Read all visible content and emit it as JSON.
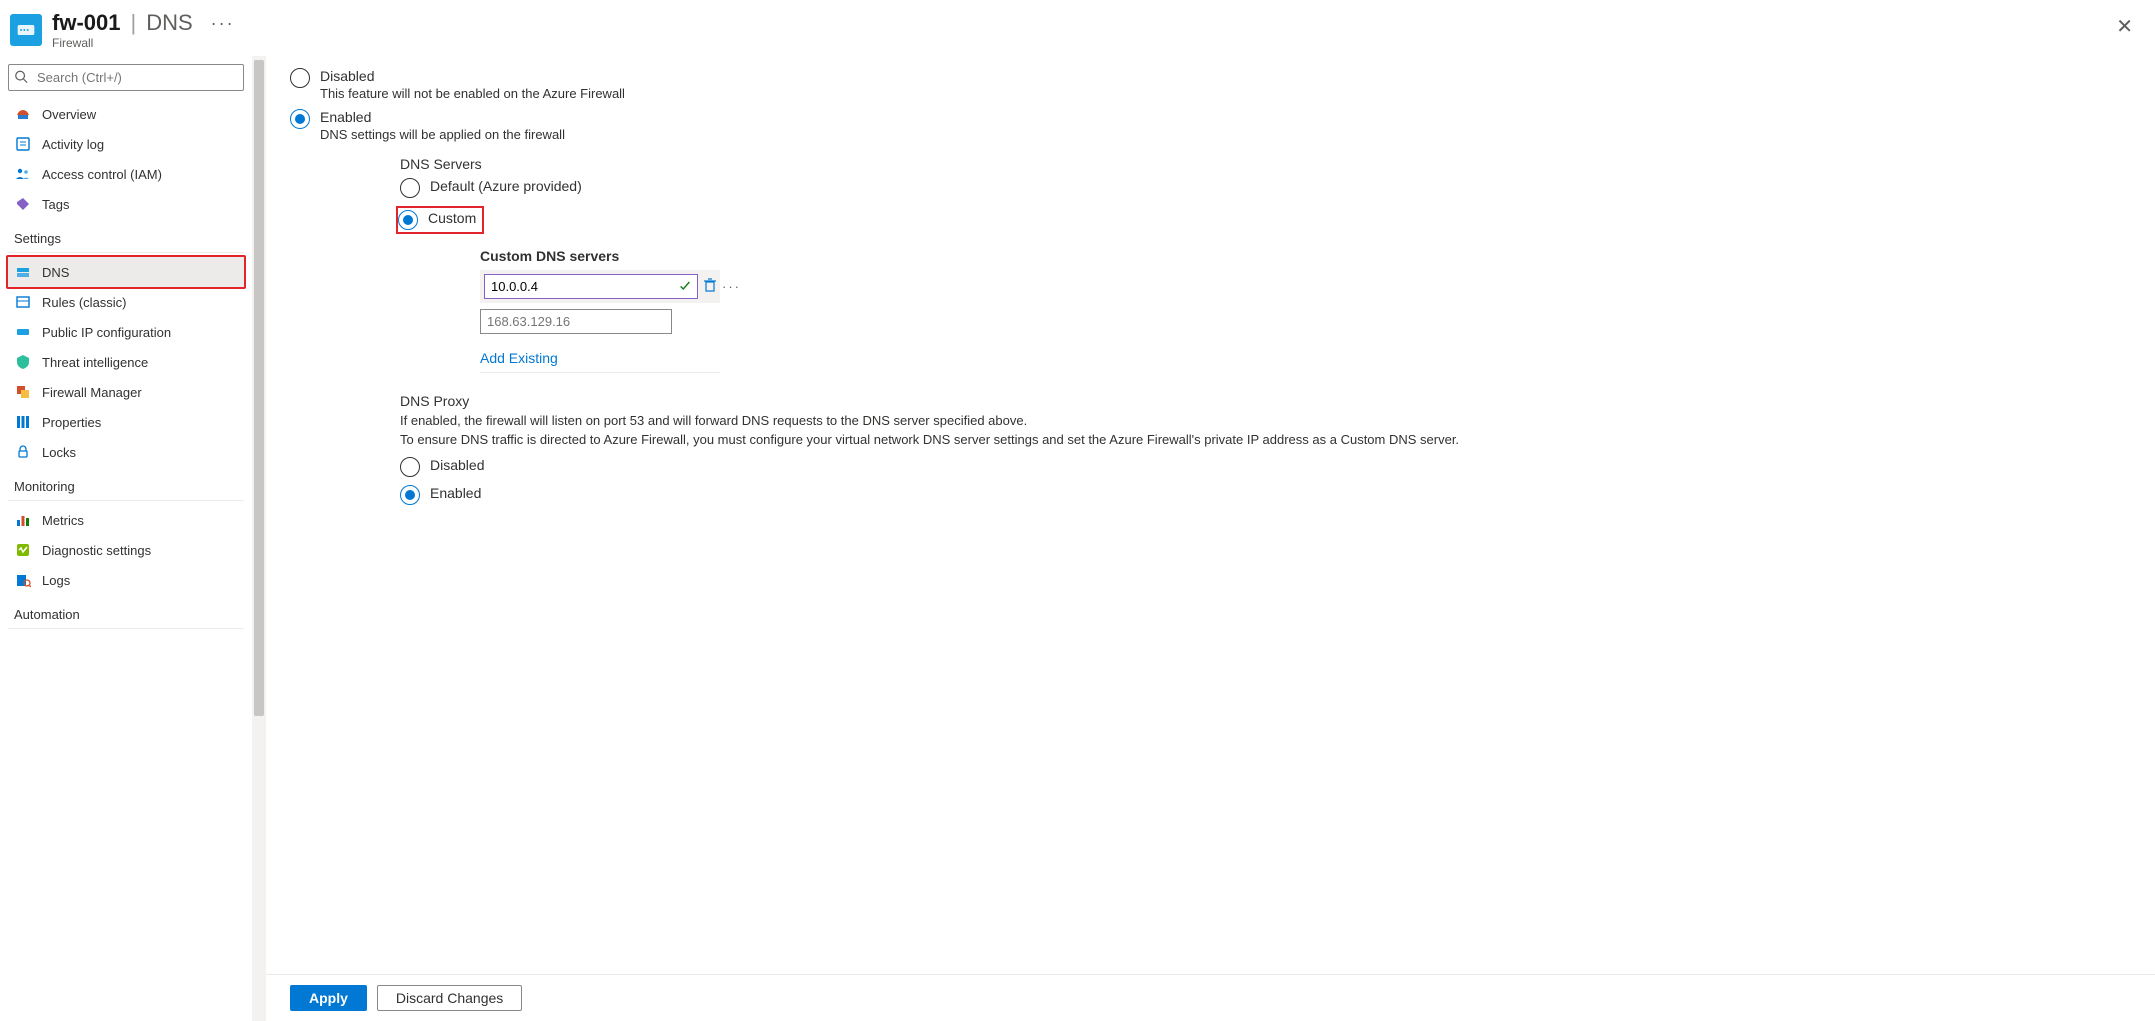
{
  "header": {
    "resource_name": "fw-001",
    "page_name": "DNS",
    "resource_type": "Firewall"
  },
  "search": {
    "placeholder": "Search (Ctrl+/)"
  },
  "nav": {
    "overview": "Overview",
    "activity": "Activity log",
    "iam": "Access control (IAM)",
    "tags": "Tags",
    "section_settings": "Settings",
    "dns": "DNS",
    "rules": "Rules (classic)",
    "pip": "Public IP configuration",
    "threat": "Threat intelligence",
    "fwmgr": "Firewall Manager",
    "props": "Properties",
    "locks": "Locks",
    "section_monitoring": "Monitoring",
    "metrics": "Metrics",
    "diag": "Diagnostic settings",
    "logs": "Logs",
    "section_automation": "Automation"
  },
  "content": {
    "disabled_label": "Disabled",
    "disabled_desc": "This feature will not be enabled on the Azure Firewall",
    "enabled_label": "Enabled",
    "enabled_desc": "DNS settings will be applied on the firewall",
    "dns_servers_label": "DNS Servers",
    "dns_default": "Default (Azure provided)",
    "dns_custom": "Custom",
    "custom_servers_label": "Custom DNS servers",
    "server_value": "10.0.0.4",
    "server_placeholder": "168.63.129.16",
    "add_existing": "Add Existing",
    "proxy_label": "DNS Proxy",
    "proxy_desc1": "If enabled, the firewall will listen on port 53 and will forward DNS requests to the DNS server specified above.",
    "proxy_desc2": "To ensure DNS traffic is directed to Azure Firewall, you must configure your virtual network DNS server settings and set the Azure Firewall's private IP address as a Custom DNS server.",
    "proxy_disabled": "Disabled",
    "proxy_enabled": "Enabled"
  },
  "footer": {
    "apply": "Apply",
    "discard": "Discard Changes"
  }
}
